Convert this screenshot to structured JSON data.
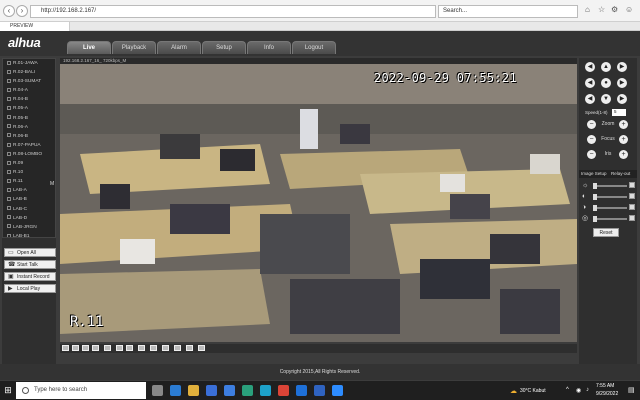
{
  "browser": {
    "url": "http://192.168.2.167/",
    "search_placeholder": "Search...",
    "tab_title": "PREVIEW"
  },
  "brand": "alhua",
  "menu": {
    "tabs": [
      "Live",
      "Playback",
      "Alarm",
      "Setup",
      "Info",
      "Logout"
    ],
    "active": "Live"
  },
  "channels": [
    "R.01-JAWA",
    "R.02-BALI",
    "R.03-SUMAT",
    "R.04-A",
    "R.04-B",
    "R.05-A",
    "R.05-B",
    "R.06-A",
    "R.06-B",
    "R.07-PAPUA",
    "R.08-LOMBO",
    "R.09",
    "R.10",
    "R.11",
    "LAB-A",
    "LAB-B",
    "LAB-C",
    "LAB-D",
    "LAB-JRGN",
    "LAB-B1"
  ],
  "channel_selected_marker": "M",
  "left_buttons": {
    "open_all": "Open All",
    "start_talk": "Start Talk",
    "instant_record": "Instant Record",
    "local_play": "Local Play"
  },
  "video": {
    "header": "192.168.2.167_16_ 720kbps_M",
    "timestamp": "2022-09-29  07:55:21",
    "channel_label": "R.11"
  },
  "ptz": {
    "speed_label": "Speed(1-8)",
    "speed_value": "5",
    "zoom": "Zoom",
    "focus": "Focus",
    "iris": "Iris",
    "image_setup": "Image Setup",
    "relay_out": "Relay-out",
    "reset": "Reset",
    "arrows": [
      "◀",
      "▲",
      "▶",
      "◀",
      "●",
      "▶",
      "◀",
      "▼",
      "▶"
    ]
  },
  "footer": {
    "copyright": "Copyright 2015,All Rights Reserved."
  },
  "taskbar": {
    "search": "Type here to search",
    "weather": "30°C  Kabut",
    "time": "7:55 AM",
    "date": "9/29/2022"
  },
  "colors": {
    "accent": "#ffffff",
    "chrome": "#333333"
  }
}
